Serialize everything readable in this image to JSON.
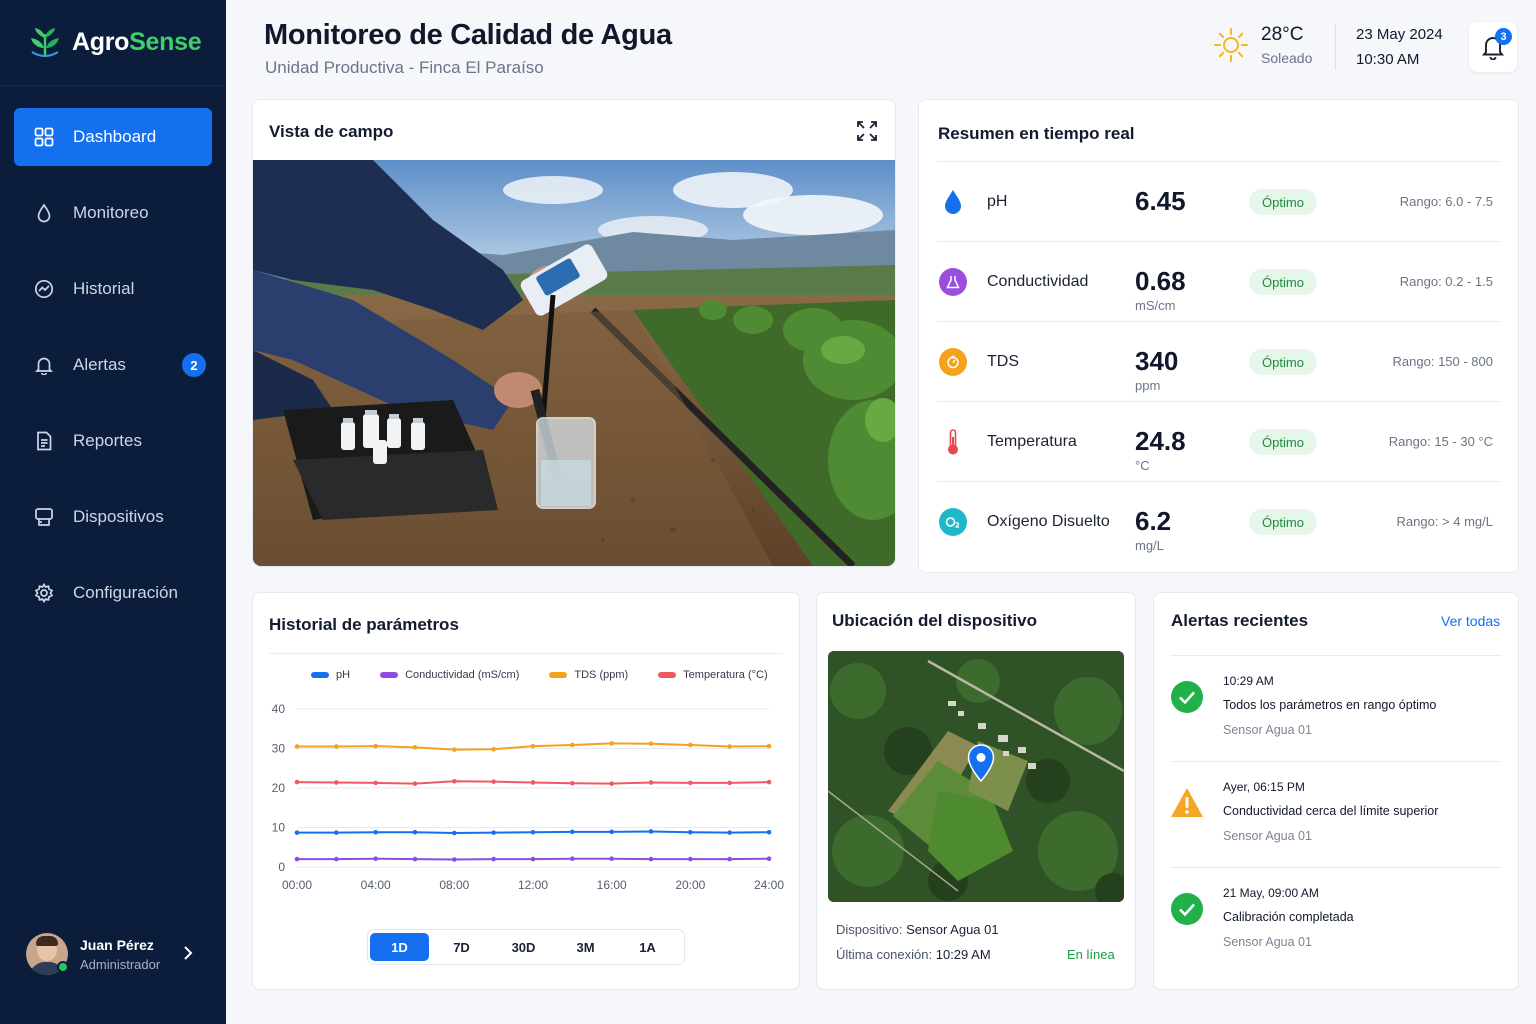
{
  "app": {
    "name_part1": "Agro",
    "name_part2": "Sense",
    "accent_color": "#3ecf6b",
    "sidebar_color": "#0b1d3a",
    "primary_color": "#1570ef"
  },
  "sidebar": {
    "items": [
      {
        "label": "Dashboard",
        "icon": "grid-icon",
        "active": true
      },
      {
        "label": "Monitoreo",
        "icon": "droplet-icon"
      },
      {
        "label": "Historial",
        "icon": "history-icon"
      },
      {
        "label": "Alertas",
        "icon": "bell-icon",
        "badge": "2"
      },
      {
        "label": "Reportes",
        "icon": "document-icon"
      },
      {
        "label": "Dispositivos",
        "icon": "device-icon"
      },
      {
        "label": "Configuración",
        "icon": "gear-icon"
      }
    ],
    "user": {
      "name": "Juan Pérez",
      "role": "Administrador"
    }
  },
  "header": {
    "title": "Monitoreo de Calidad de Agua",
    "subtitle": "Unidad Productiva - Finca El Paraíso",
    "weather": {
      "temp": "28°C",
      "condition": "Soleado",
      "icon": "sun-icon"
    },
    "date": "23 May 2024",
    "time": "10:30 AM",
    "notifications": "3"
  },
  "field_view": {
    "title": "Vista de campo",
    "icon": "expand-icon"
  },
  "summary": {
    "title": "Resumen en tiempo real",
    "rows": [
      {
        "name": "pH",
        "value": "6.45",
        "unit": "",
        "status": "Óptimo",
        "range": "Rango: 6.0 - 7.5",
        "icon": "droplet-icon",
        "color": "#1570ef"
      },
      {
        "name": "Conductividad",
        "value": "0.68",
        "unit": "mS/cm",
        "status": "Óptimo",
        "range": "Rango: 0.2 - 1.5",
        "icon": "flask-icon",
        "color": "#9b4dde"
      },
      {
        "name": "TDS",
        "value": "340",
        "unit": "ppm",
        "status": "Óptimo",
        "range": "Rango: 150 - 800",
        "icon": "gauge-icon",
        "color": "#f4a21c"
      },
      {
        "name": "Temperatura",
        "value": "24.8",
        "unit": "°C",
        "status": "Óptimo",
        "range": "Rango: 15 - 30 °C",
        "icon": "thermometer-icon",
        "color": "#e5484d"
      },
      {
        "name": "Oxígeno Disuelto",
        "value": "6.2",
        "unit": "mg/L",
        "status": "Óptimo",
        "range": "Rango: > 4 mg/L",
        "icon": "oxygen-icon",
        "color": "#1fb8c9"
      }
    ]
  },
  "history": {
    "title": "Historial de parámetros",
    "range_tabs": [
      "1D",
      "7D",
      "30D",
      "3M",
      "1A"
    ],
    "active_tab": "1D"
  },
  "chart_data": {
    "type": "line",
    "x": [
      "00:00",
      "02:00",
      "04:00",
      "06:00",
      "08:00",
      "10:00",
      "12:00",
      "14:00",
      "16:00",
      "18:00",
      "20:00",
      "22:00",
      "24:00"
    ],
    "xticks": [
      "00:00",
      "04:00",
      "08:00",
      "12:00",
      "16:00",
      "20:00",
      "24:00"
    ],
    "ylim": [
      0,
      40
    ],
    "yticks": [
      0,
      10,
      20,
      30,
      40
    ],
    "grid": true,
    "legend_position": "top",
    "series": [
      {
        "name": "pH",
        "color": "#1570ef",
        "values": [
          8.7,
          8.7,
          8.8,
          8.8,
          8.6,
          8.7,
          8.8,
          8.9,
          8.9,
          9.0,
          8.8,
          8.7,
          8.8
        ]
      },
      {
        "name": "Conductividad (mS/cm)",
        "color": "#8b4de0",
        "values": [
          2.0,
          2.0,
          2.1,
          2.0,
          1.9,
          2.0,
          2.0,
          2.1,
          2.1,
          2.0,
          2.0,
          2.0,
          2.1
        ]
      },
      {
        "name": "TDS (ppm)",
        "color": "#f4a21c",
        "values": [
          30.5,
          30.5,
          30.6,
          30.3,
          29.7,
          29.8,
          30.6,
          30.9,
          31.3,
          31.2,
          30.9,
          30.5,
          30.6
        ]
      },
      {
        "name": "Temperatura (°C)",
        "color": "#ee5a63",
        "values": [
          21.5,
          21.4,
          21.3,
          21.1,
          21.7,
          21.6,
          21.4,
          21.2,
          21.1,
          21.4,
          21.3,
          21.3,
          21.5
        ]
      }
    ]
  },
  "device_location": {
    "title": "Ubicación del dispositivo",
    "device_label": "Dispositivo:",
    "device_name": "Sensor Agua 01",
    "last_conn_label": "Última conexión:",
    "last_conn": "10:29 AM",
    "status": "En línea"
  },
  "alerts": {
    "title": "Alertas recientes",
    "see_all": "Ver todas",
    "items": [
      {
        "time": "10:29 AM",
        "message": "Todos los parámetros en rango óptimo",
        "source": "Sensor Agua 01",
        "icon": "check-circle-icon",
        "color": "#22b04b"
      },
      {
        "time": "Ayer, 06:15 PM",
        "message": "Conductividad cerca del límite superior",
        "source": "Sensor Agua 01",
        "icon": "warning-icon",
        "color": "#f5a623"
      },
      {
        "time": "21 May, 09:00 AM",
        "message": "Calibración completada",
        "source": "Sensor Agua 01",
        "icon": "check-circle-icon",
        "color": "#22b04b"
      }
    ]
  }
}
